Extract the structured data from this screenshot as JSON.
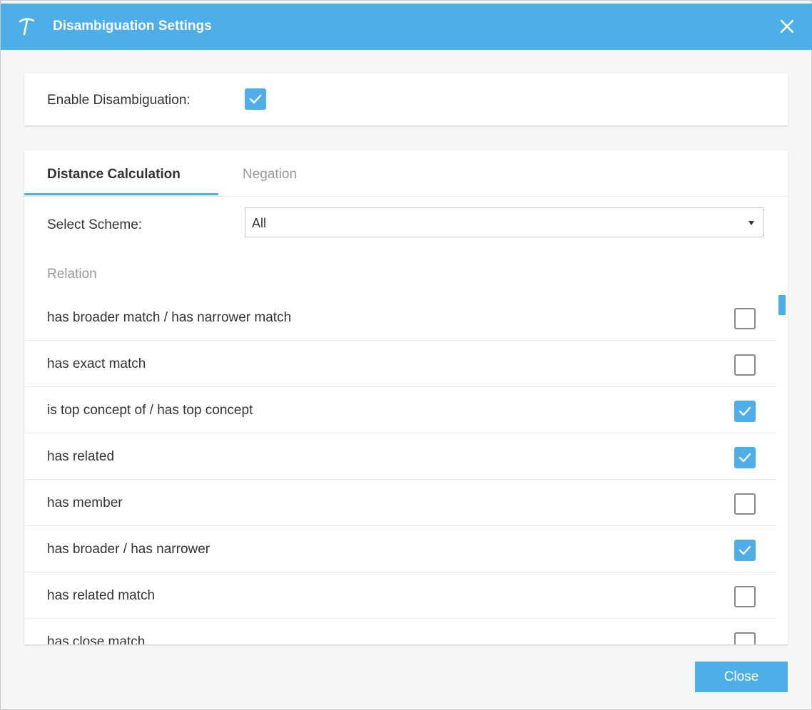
{
  "dialog": {
    "title": "Disambiguation Settings",
    "close_icon": "close-icon",
    "logo_icon": "app-logo-icon"
  },
  "enable": {
    "label": "Enable Disambiguation:",
    "checked": true
  },
  "tabs": [
    {
      "label": "Distance Calculation",
      "active": true
    },
    {
      "label": "Negation",
      "active": false
    }
  ],
  "scheme": {
    "label": "Select Scheme:",
    "selected": "All"
  },
  "relations": {
    "header": "Relation",
    "items": [
      {
        "label": "has broader match / has narrower match",
        "checked": false
      },
      {
        "label": "has exact match",
        "checked": false
      },
      {
        "label": "is top concept of / has top concept",
        "checked": true
      },
      {
        "label": "has related",
        "checked": true
      },
      {
        "label": "has member",
        "checked": false
      },
      {
        "label": "has broader / has narrower",
        "checked": true
      },
      {
        "label": "has related match",
        "checked": false
      },
      {
        "label": "has close match",
        "checked": false
      }
    ]
  },
  "footer": {
    "close_label": "Close"
  },
  "colors": {
    "accent": "#4daee8"
  }
}
